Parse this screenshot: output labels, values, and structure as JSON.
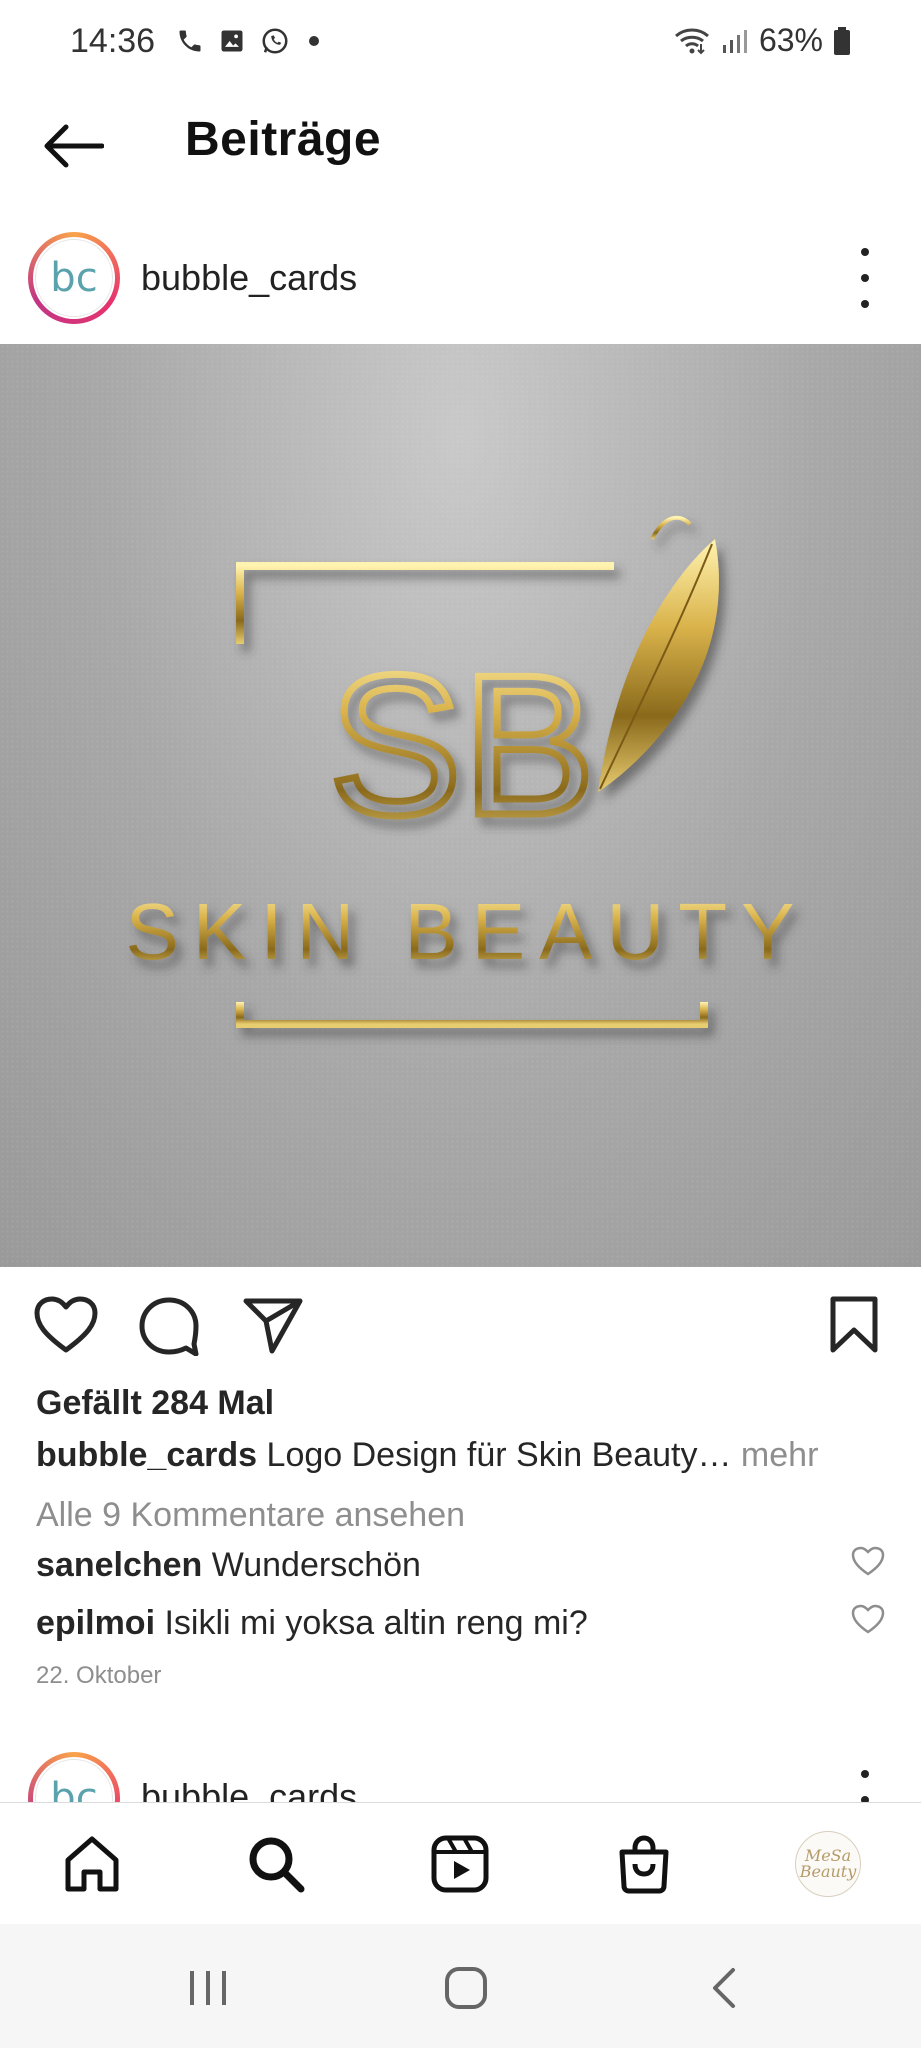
{
  "status_bar": {
    "time": "14:36",
    "battery": "63%",
    "icons": [
      "phone-icon",
      "gallery-icon",
      "whatsapp-icon",
      "dot-icon",
      "wifi-icon",
      "signal-icon",
      "battery-icon"
    ]
  },
  "header": {
    "title": "Beiträge",
    "back_icon": "arrow-left-icon"
  },
  "post": {
    "username": "bubble_cards",
    "avatar_text": "bc",
    "image": {
      "monogram": "SB",
      "brand_text": "SKIN BEAUTY",
      "colors": {
        "gold": "#d4af37",
        "gold_dark": "#8a6d1e",
        "background": "#a9a9a9"
      }
    },
    "likes_text": "Gefällt 284 Mal",
    "caption_user": "bubble_cards",
    "caption_text": "Logo Design für Skin Beauty…",
    "caption_more": "mehr",
    "view_comments": "Alle 9 Kommentare ansehen",
    "comments": [
      {
        "user": "sanelchen",
        "text": "Wunderschön"
      },
      {
        "user": "epilmoi",
        "text": "Isikli mi yoksa altin reng mi?"
      }
    ],
    "date": "22. Oktober"
  },
  "next_post": {
    "username": "bubble_cards",
    "avatar_text": "bc"
  },
  "bottom_nav": {
    "items": [
      "home-icon",
      "search-icon",
      "reels-icon",
      "shop-icon",
      "profile-avatar"
    ],
    "profile_text_top": "MeSa",
    "profile_text_bottom": "Beauty"
  }
}
